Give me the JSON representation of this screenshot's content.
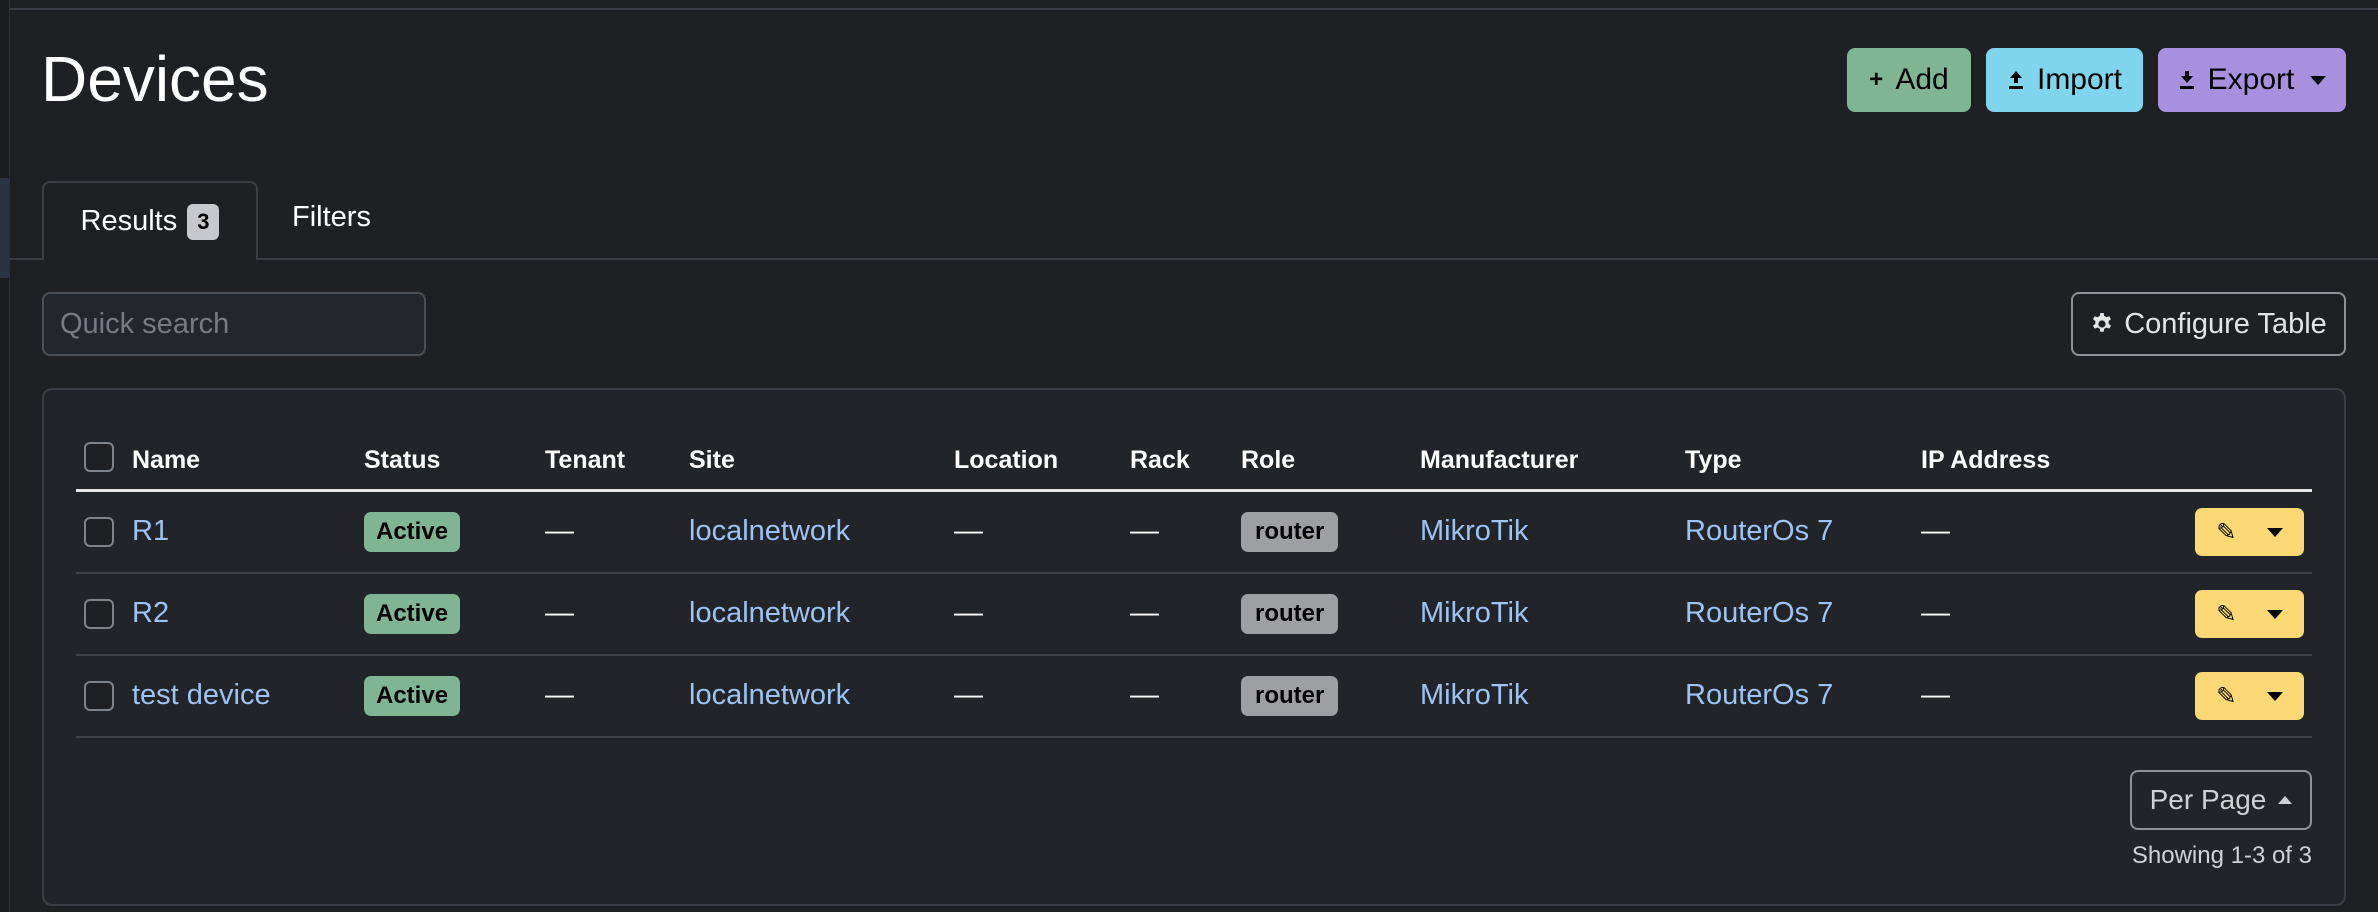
{
  "page": {
    "title": "Devices"
  },
  "header_buttons": {
    "add": {
      "label": "Add",
      "icon": "plus-icon"
    },
    "import": {
      "label": "Import",
      "icon": "upload-icon"
    },
    "export": {
      "label": "Export",
      "icon": "download-icon"
    }
  },
  "tabs": {
    "results": {
      "label": "Results",
      "count": "3"
    },
    "filters": {
      "label": "Filters"
    }
  },
  "search": {
    "placeholder": "Quick search",
    "value": ""
  },
  "configure_table": {
    "label": "Configure Table",
    "icon": "gear-icon"
  },
  "table": {
    "columns": [
      "Name",
      "Status",
      "Tenant",
      "Site",
      "Location",
      "Rack",
      "Role",
      "Manufacturer",
      "Type",
      "IP Address"
    ],
    "rows": [
      {
        "name": "R1",
        "status": "Active",
        "tenant": "—",
        "site": "localnetwork",
        "location": "—",
        "rack": "—",
        "role": "router",
        "manufacturer": "MikroTik",
        "type": "RouterOs 7",
        "ip_address": "—"
      },
      {
        "name": "R2",
        "status": "Active",
        "tenant": "—",
        "site": "localnetwork",
        "location": "—",
        "rack": "—",
        "role": "router",
        "manufacturer": "MikroTik",
        "type": "RouterOs 7",
        "ip_address": "—"
      },
      {
        "name": "test device",
        "status": "Active",
        "tenant": "—",
        "site": "localnetwork",
        "location": "—",
        "rack": "—",
        "role": "router",
        "manufacturer": "MikroTik",
        "type": "RouterOs 7",
        "ip_address": "—"
      }
    ]
  },
  "pagination": {
    "per_page_label": "Per Page",
    "showing": "Showing 1-3 of 3"
  },
  "colors": {
    "background": "#1e2024",
    "add": "#7fb592",
    "import": "#7fd4ee",
    "export": "#a890de",
    "link": "#9ec3f2",
    "status_active": "#7fb592",
    "role_badge": "#9d9fa3",
    "row_action": "#fcd974"
  }
}
